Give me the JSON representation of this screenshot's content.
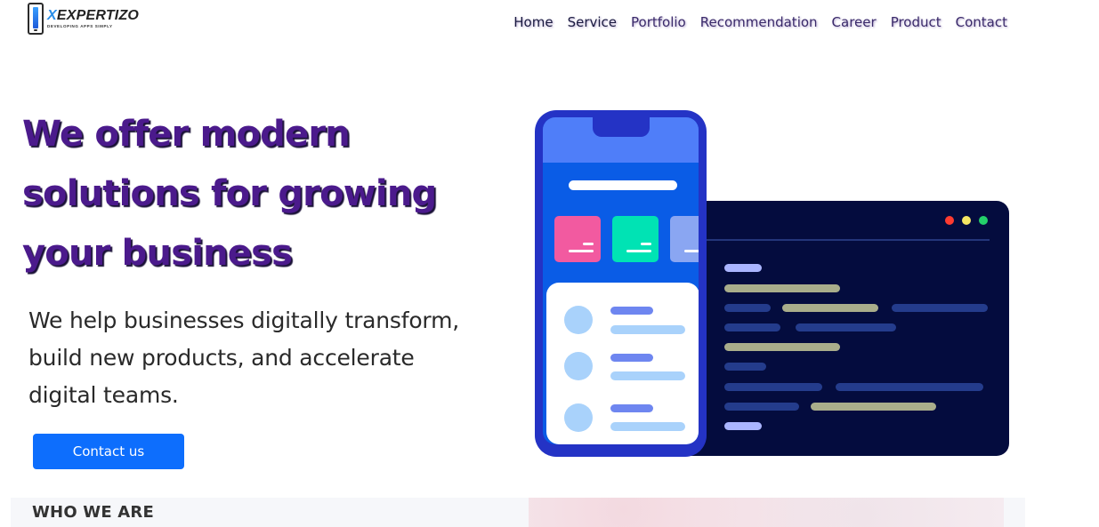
{
  "brand": {
    "name_prefix": "X",
    "name_main": "EXPERTIZO",
    "tagline": "DEVELOPING APPS SIMPLY"
  },
  "nav": {
    "items": [
      {
        "label": "Home"
      },
      {
        "label": "Service"
      },
      {
        "label": "Portfolio"
      },
      {
        "label": "Recommendation"
      },
      {
        "label": "Career"
      },
      {
        "label": "Product"
      },
      {
        "label": "Contact"
      }
    ]
  },
  "hero": {
    "title": "We offer modern solutions for growing your business",
    "subtitle": "We help businesses digitally transform, build new products, and accelerate digital teams.",
    "cta_label": "Contact us"
  },
  "section": {
    "who_we_are": "WHO WE ARE"
  },
  "colors": {
    "accent": "#0d6efd",
    "title": "#4b1a8c",
    "code_bg": "#040c3e",
    "phone": "#2433c5"
  },
  "icons": {
    "logo": "phone-logo-icon",
    "window_dots": [
      "red-dot-icon",
      "yellow-dot-icon",
      "green-dot-icon"
    ]
  }
}
